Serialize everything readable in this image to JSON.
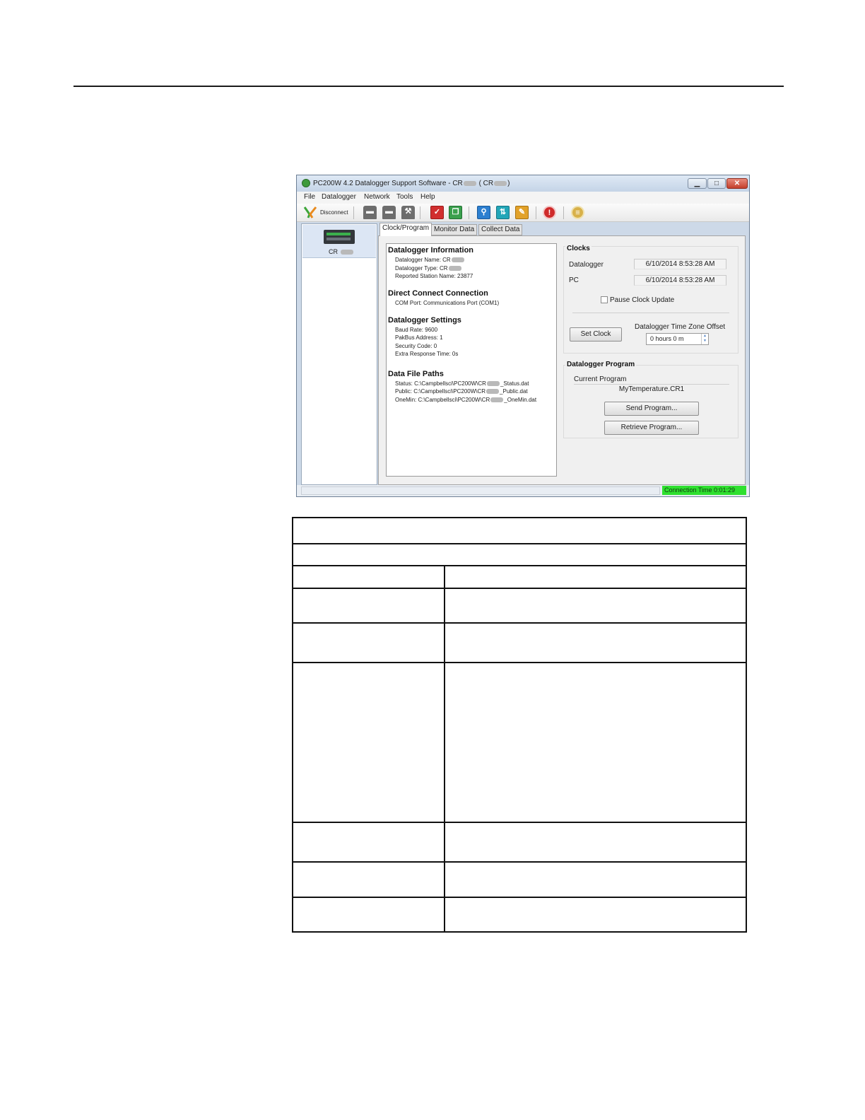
{
  "window": {
    "title_prefix": "PC200W 4.2 Datalogger Support Software - CR",
    "title_mid": "( CR",
    "title_suffix": ")",
    "min_glyph": "▁",
    "max_glyph": "□",
    "close_glyph": "✕"
  },
  "menu": [
    "File",
    "Datalogger",
    "Network",
    "Tools",
    "Help"
  ],
  "toolbar": {
    "disconnect_label": "Disconnect",
    "icons": [
      "datalogger-a-icon",
      "datalogger-b-icon",
      "datalogger-wrench-icon",
      "checklist-icon",
      "copy-icon",
      "search-icon",
      "share-icon",
      "edit-icon",
      "stop-icon",
      "notes-icon"
    ]
  },
  "station": {
    "label": "CR"
  },
  "tabs": [
    "Clock/Program",
    "Monitor Data",
    "Collect Data"
  ],
  "info": {
    "datalogger_info": {
      "heading": "Datalogger Information",
      "name": "Datalogger Name: CR",
      "type": "Datalogger Type: CR",
      "station": "Reported Station Name: 23877"
    },
    "connection": {
      "heading": "Direct Connect Connection",
      "com": "COM Port: Communications Port (COM1)"
    },
    "settings": {
      "heading": "Datalogger Settings",
      "baud": "Baud Rate: 9600",
      "pakbus": "PakBus Address: 1",
      "security": "Security Code: 0",
      "extra": "Extra Response Time: 0s"
    },
    "paths": {
      "heading": "Data File Paths",
      "status_prefix": "Status: C:\\Campbellsci\\PC200W\\CR",
      "status_suffix": "_Status.dat",
      "public_prefix": "Public: C:\\Campbellsci\\PC200W\\CR",
      "public_suffix": "_Public.dat",
      "onemin_prefix": "OneMin: C:\\Campbellsci\\PC200W\\CR",
      "onemin_suffix": "_OneMin.dat"
    }
  },
  "clocks": {
    "title": "Clocks",
    "datalogger_label": "Datalogger",
    "datalogger_time": "6/10/2014 8:53:28 AM",
    "pc_label": "PC",
    "pc_time": "6/10/2014 8:53:28 AM",
    "pause_label": "Pause Clock Update",
    "set_clock": "Set Clock",
    "tz_label": "Datalogger Time Zone Offset",
    "tz_value": "0 hours 0 m"
  },
  "program": {
    "title": "Datalogger Program",
    "current_label": "Current Program",
    "current_value": "MyTemperature.CR1",
    "send": "Send Program...",
    "retrieve": "Retrieve Program..."
  },
  "status": {
    "connection_time": "Connection Time 0:01:29"
  }
}
